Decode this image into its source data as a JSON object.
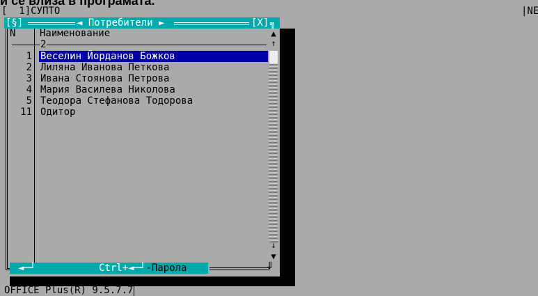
{
  "page_title": "и се влиза в програмата.",
  "top_bar": {
    "left_text": "[  1]СУПТО",
    "right_text": "|NE"
  },
  "window": {
    "left_control": "[§]",
    "title": "◄ Потребители ►",
    "close": "[X]",
    "corner": "╗"
  },
  "table": {
    "col_n_header": "N",
    "col_name_header": "Наименование",
    "sub_header": "2",
    "rows": [
      {
        "n": "1",
        "name": "Веселин Йорданов Божков",
        "selected": true
      },
      {
        "n": "2",
        "name": "Лиляна Иванова Петкова",
        "selected": false
      },
      {
        "n": "3",
        "name": "Ивана Стоянова Петрова",
        "selected": false
      },
      {
        "n": "4",
        "name": "Мария Василева Николова",
        "selected": false
      },
      {
        "n": "5",
        "name": "Теодора Стефанова Тодорова",
        "selected": false
      },
      {
        "n": "11",
        "name": "Одитор",
        "selected": false
      }
    ]
  },
  "scrollbar": {
    "up": "▲",
    "page_up": "↑",
    "page_down": "↓",
    "down": "▼"
  },
  "statusbar": {
    "enter_label": "◄─┘",
    "ctrl_prefix": "Ctrl+◄─┘",
    "ctrl_suffix": "-Парола",
    "corner": "╜"
  },
  "footer": {
    "version": "OFFICE Plus(R) 9.5.7.7"
  },
  "colors": {
    "background": "#aaaaaa",
    "titlebar": "#00aaaa",
    "selection": "#0000aa",
    "shadow": "#000000"
  }
}
